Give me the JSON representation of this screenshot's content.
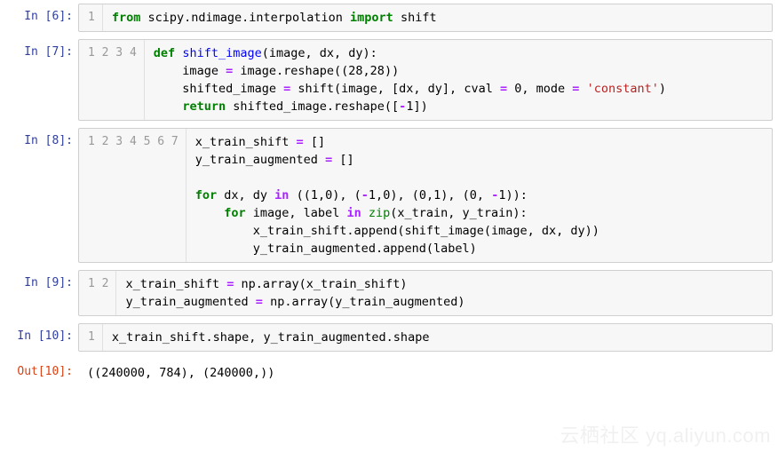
{
  "cells": [
    {
      "kind": "in",
      "prompt": "In [6]:",
      "gutter": [
        "1"
      ],
      "code": "<span class='kw'>from</span> scipy.ndimage.interpolation <span class='kw'>import</span> shift"
    },
    {
      "kind": "in",
      "prompt": "In [7]:",
      "gutter": [
        "1",
        "2",
        "3",
        "4"
      ],
      "code": "<span class='kw'>def</span> <span class='fn'>shift_image</span>(image, dx, dy):\n    image <span class='op'>=</span> image.reshape((<span class='num'>28</span>,<span class='num'>28</span>))\n    shifted_image <span class='op'>=</span> shift(image, [dx, dy], cval <span class='op'>=</span> <span class='num'>0</span>, mode <span class='op'>=</span> <span class='str'>'constant'</span>)\n    <span class='kw'>return</span> shifted_image.reshape([<span class='op'>-</span><span class='num'>1</span>])"
    },
    {
      "kind": "in",
      "prompt": "In [8]:",
      "gutter": [
        "1",
        "2",
        "3",
        "4",
        "5",
        "6",
        "7"
      ],
      "code": "x_train_shift <span class='op'>=</span> []\ny_train_augmented <span class='op'>=</span> []\n\n<span class='kw'>for</span> dx, dy <span class='op'>in</span> ((<span class='num'>1</span>,<span class='num'>0</span>), (<span class='op'>-</span><span class='num'>1</span>,<span class='num'>0</span>), (<span class='num'>0</span>,<span class='num'>1</span>), (<span class='num'>0</span>, <span class='op'>-</span><span class='num'>1</span>)):\n    <span class='kw'>for</span> image, label <span class='op'>in</span> <span class='bi'>zip</span>(x_train, y_train):\n        x_train_shift.append(shift_image(image, dx, dy))\n        y_train_augmented.append(label)"
    },
    {
      "kind": "in",
      "prompt": "In [9]:",
      "gutter": [
        "1",
        "2"
      ],
      "code": "x_train_shift <span class='op'>=</span> np.array(x_train_shift)\ny_train_augmented <span class='op'>=</span> np.array(y_train_augmented)"
    },
    {
      "kind": "in",
      "prompt": "In [10]:",
      "gutter": [
        "1"
      ],
      "code": "x_train_shift.shape, y_train_augmented.shape"
    },
    {
      "kind": "out",
      "prompt": "Out[10]:",
      "output": "((240000, 784), (240000,))"
    }
  ],
  "watermark": "云栖社区 yq.aliyun.com"
}
